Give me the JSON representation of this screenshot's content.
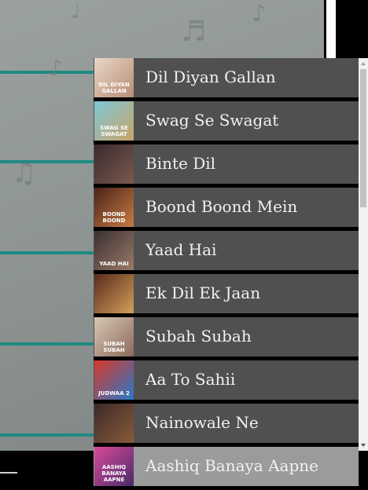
{
  "songs": [
    {
      "title": "Dil Diyan Gallan",
      "thumb_text": "DIL DIYAN GALLAN",
      "thumb_colors": [
        "#e9d7c9",
        "#b88d74"
      ]
    },
    {
      "title": "Swag Se Swagat",
      "thumb_text": "SWAG SE SWAGAT",
      "thumb_colors": [
        "#7ec7d6",
        "#c9a46a"
      ]
    },
    {
      "title": "Binte Dil",
      "thumb_text": "",
      "thumb_colors": [
        "#3a2a2c",
        "#7a5a4f"
      ]
    },
    {
      "title": "Boond Boond Mein",
      "thumb_text": "BOOND BOOND",
      "thumb_colors": [
        "#4a2318",
        "#c77b45"
      ]
    },
    {
      "title": "Yaad Hai",
      "thumb_text": "YAAD HAI",
      "thumb_colors": [
        "#3a3030",
        "#9a7a6a"
      ]
    },
    {
      "title": "Ek Dil Ek Jaan",
      "thumb_text": "",
      "thumb_colors": [
        "#5a2a1c",
        "#d2a05a"
      ]
    },
    {
      "title": "Subah Subah",
      "thumb_text": "SUBAH SUBAH",
      "thumb_colors": [
        "#d9c7b6",
        "#8a6a5a"
      ]
    },
    {
      "title": "Aa To Sahii",
      "thumb_text": "JUDWAA 2",
      "thumb_colors": [
        "#d9382a",
        "#2a78c9"
      ]
    },
    {
      "title": "Nainowale Ne",
      "thumb_text": "",
      "thumb_colors": [
        "#3a2a2a",
        "#8a5a3a"
      ]
    },
    {
      "title": "Aashiq Banaya Aapne",
      "thumb_text": "AASHIQ BANAYA AAPNE",
      "thumb_colors": [
        "#d94a9a",
        "#4a2a6a"
      ]
    }
  ],
  "active_index": 9,
  "colors": {
    "item_bg": "#505050",
    "item_active_bg": "#9b9b9b",
    "accent_teal": "#1f8a82"
  },
  "scroll_position": 0.0
}
